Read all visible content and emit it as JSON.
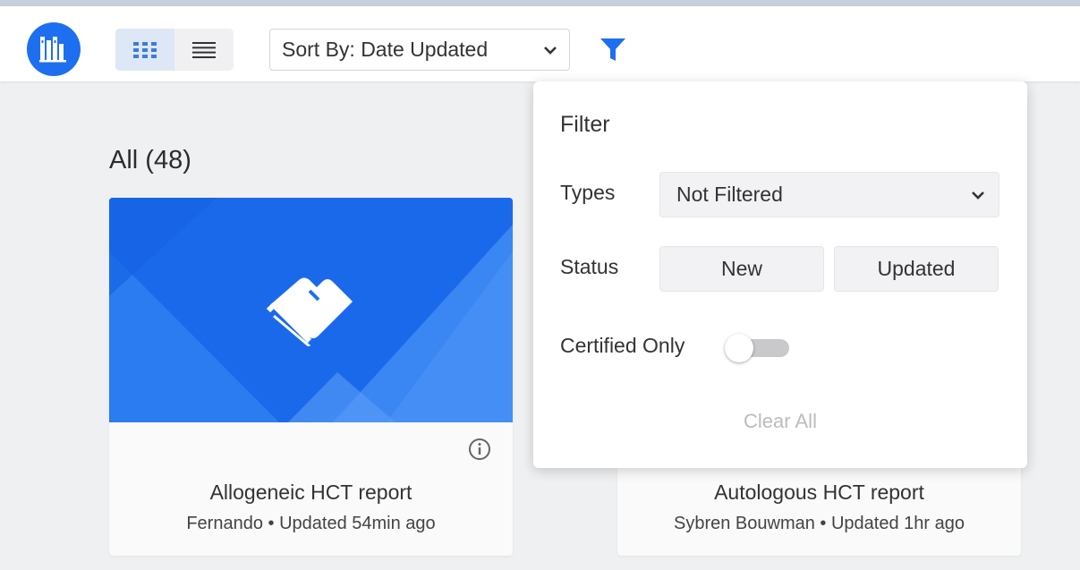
{
  "header": {
    "logo_icon": "library-books-icon",
    "view_toggle": {
      "grid_icon": "grid-view-icon",
      "list_icon": "list-view-icon",
      "active": "grid"
    },
    "sort": {
      "label": "Sort By: Date Updated",
      "chevron_icon": "chevron-down-icon"
    },
    "filter_icon": "filter-funnel-icon",
    "accent_color": "#1e6ff0"
  },
  "main": {
    "section_title": "All (48)",
    "cards": [
      {
        "title": "Allogeneic HCT report",
        "meta": "Fernando • Updated 54min ago",
        "thumb_icon": "books-logo-icon",
        "info_icon": "info-icon"
      },
      {
        "title": "Autologous HCT report",
        "meta": "Sybren Bouwman • Updated 1hr ago"
      }
    ]
  },
  "filter_panel": {
    "title": "Filter",
    "types_label": "Types",
    "types_value": "Not Filtered",
    "status_label": "Status",
    "status_options": [
      "New",
      "Updated"
    ],
    "certified_label": "Certified Only",
    "certified_on": false,
    "clear_all": "Clear All"
  }
}
